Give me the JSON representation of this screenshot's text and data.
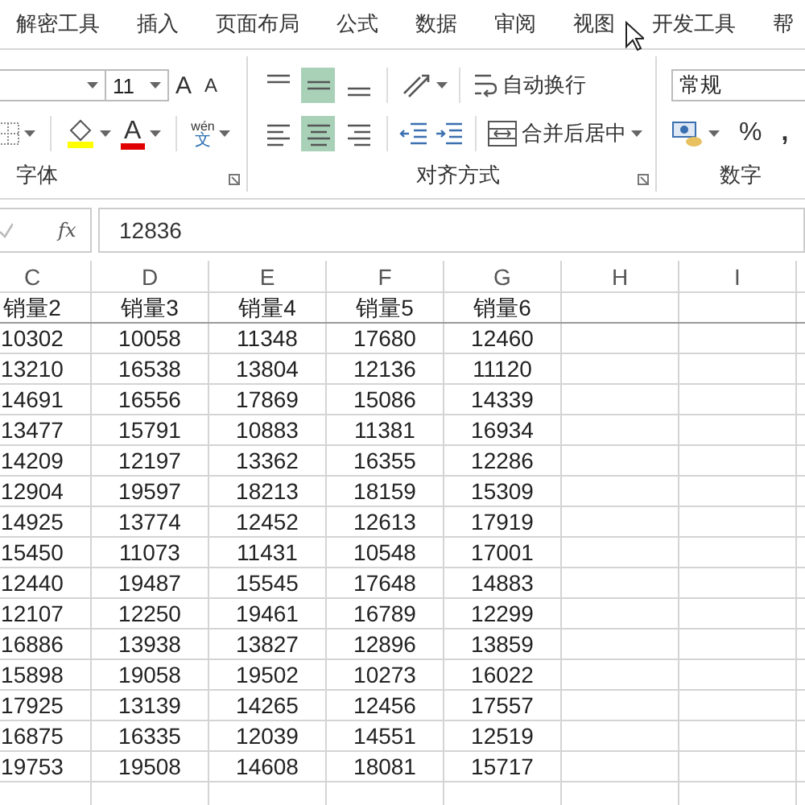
{
  "ribbon_tabs": [
    {
      "label": "解密工具"
    },
    {
      "label": "插入"
    },
    {
      "label": "页面布局"
    },
    {
      "label": "公式"
    },
    {
      "label": "数据"
    },
    {
      "label": "审阅"
    },
    {
      "label": "视图"
    },
    {
      "label": "开发工具"
    },
    {
      "label": "帮"
    }
  ],
  "font_group": {
    "font_size": "11",
    "grow_font": "A",
    "shrink_font": "A",
    "font_color_letter": "A",
    "phonetic_top": "wén",
    "phonetic_bottom": "文",
    "label": "字体"
  },
  "alignment_group": {
    "vertical": [
      {
        "kind": "top",
        "selected": false
      },
      {
        "kind": "middle",
        "selected": true
      },
      {
        "kind": "bottom",
        "selected": false
      }
    ],
    "horizontal": [
      {
        "kind": "left",
        "selected": false
      },
      {
        "kind": "center",
        "selected": true
      },
      {
        "kind": "right",
        "selected": false
      }
    ],
    "wrap_text": "自动换行",
    "merge_center": "合并后居中",
    "label": "对齐方式"
  },
  "number_group": {
    "format": "常规",
    "percent": "%",
    "comma": ",",
    "label": "数字"
  },
  "formula_bar": {
    "fx": "fx",
    "value": "12836"
  },
  "columns": [
    "C",
    "D",
    "E",
    "F",
    "G",
    "H",
    "I"
  ],
  "rows": [
    [
      "销量2",
      "销量3",
      "销量4",
      "销量5",
      "销量6"
    ],
    [
      "10302",
      "10058",
      "11348",
      "17680",
      "12460"
    ],
    [
      "13210",
      "16538",
      "13804",
      "12136",
      "11120"
    ],
    [
      "14691",
      "16556",
      "17869",
      "15086",
      "14339"
    ],
    [
      "13477",
      "15791",
      "10883",
      "11381",
      "16934"
    ],
    [
      "14209",
      "12197",
      "13362",
      "16355",
      "12286"
    ],
    [
      "12904",
      "19597",
      "18213",
      "18159",
      "15309"
    ],
    [
      "14925",
      "13774",
      "12452",
      "12613",
      "17919"
    ],
    [
      "15450",
      "11073",
      "11431",
      "10548",
      "17001"
    ],
    [
      "12440",
      "19487",
      "15545",
      "17648",
      "14883"
    ],
    [
      "12107",
      "12250",
      "19461",
      "16789",
      "12299"
    ],
    [
      "16886",
      "13938",
      "13827",
      "12896",
      "13859"
    ],
    [
      "15898",
      "19058",
      "19502",
      "10273",
      "16022"
    ],
    [
      "17925",
      "13139",
      "14265",
      "12456",
      "17557"
    ],
    [
      "16875",
      "16335",
      "12039",
      "14551",
      "12519"
    ],
    [
      "19753",
      "19508",
      "14608",
      "18081",
      "15717"
    ]
  ]
}
